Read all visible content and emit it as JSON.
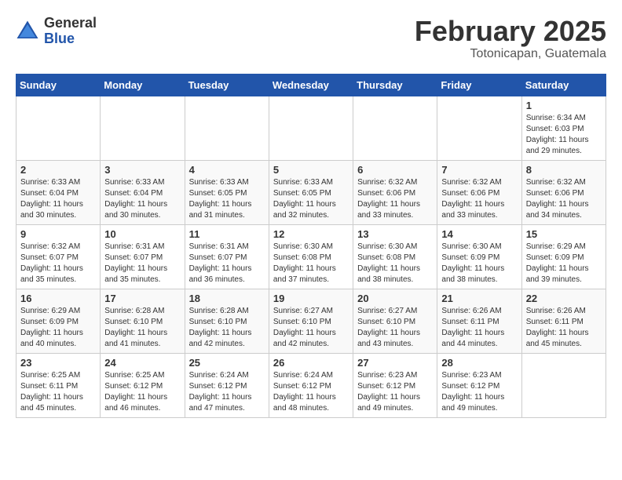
{
  "logo": {
    "general": "General",
    "blue": "Blue"
  },
  "title": "February 2025",
  "subtitle": "Totonicapan, Guatemala",
  "weekdays": [
    "Sunday",
    "Monday",
    "Tuesday",
    "Wednesday",
    "Thursday",
    "Friday",
    "Saturday"
  ],
  "weeks": [
    [
      {
        "day": "",
        "info": ""
      },
      {
        "day": "",
        "info": ""
      },
      {
        "day": "",
        "info": ""
      },
      {
        "day": "",
        "info": ""
      },
      {
        "day": "",
        "info": ""
      },
      {
        "day": "",
        "info": ""
      },
      {
        "day": "1",
        "info": "Sunrise: 6:34 AM\nSunset: 6:03 PM\nDaylight: 11 hours and 29 minutes."
      }
    ],
    [
      {
        "day": "2",
        "info": "Sunrise: 6:33 AM\nSunset: 6:04 PM\nDaylight: 11 hours and 30 minutes."
      },
      {
        "day": "3",
        "info": "Sunrise: 6:33 AM\nSunset: 6:04 PM\nDaylight: 11 hours and 30 minutes."
      },
      {
        "day": "4",
        "info": "Sunrise: 6:33 AM\nSunset: 6:05 PM\nDaylight: 11 hours and 31 minutes."
      },
      {
        "day": "5",
        "info": "Sunrise: 6:33 AM\nSunset: 6:05 PM\nDaylight: 11 hours and 32 minutes."
      },
      {
        "day": "6",
        "info": "Sunrise: 6:32 AM\nSunset: 6:06 PM\nDaylight: 11 hours and 33 minutes."
      },
      {
        "day": "7",
        "info": "Sunrise: 6:32 AM\nSunset: 6:06 PM\nDaylight: 11 hours and 33 minutes."
      },
      {
        "day": "8",
        "info": "Sunrise: 6:32 AM\nSunset: 6:06 PM\nDaylight: 11 hours and 34 minutes."
      }
    ],
    [
      {
        "day": "9",
        "info": "Sunrise: 6:32 AM\nSunset: 6:07 PM\nDaylight: 11 hours and 35 minutes."
      },
      {
        "day": "10",
        "info": "Sunrise: 6:31 AM\nSunset: 6:07 PM\nDaylight: 11 hours and 35 minutes."
      },
      {
        "day": "11",
        "info": "Sunrise: 6:31 AM\nSunset: 6:07 PM\nDaylight: 11 hours and 36 minutes."
      },
      {
        "day": "12",
        "info": "Sunrise: 6:30 AM\nSunset: 6:08 PM\nDaylight: 11 hours and 37 minutes."
      },
      {
        "day": "13",
        "info": "Sunrise: 6:30 AM\nSunset: 6:08 PM\nDaylight: 11 hours and 38 minutes."
      },
      {
        "day": "14",
        "info": "Sunrise: 6:30 AM\nSunset: 6:09 PM\nDaylight: 11 hours and 38 minutes."
      },
      {
        "day": "15",
        "info": "Sunrise: 6:29 AM\nSunset: 6:09 PM\nDaylight: 11 hours and 39 minutes."
      }
    ],
    [
      {
        "day": "16",
        "info": "Sunrise: 6:29 AM\nSunset: 6:09 PM\nDaylight: 11 hours and 40 minutes."
      },
      {
        "day": "17",
        "info": "Sunrise: 6:28 AM\nSunset: 6:10 PM\nDaylight: 11 hours and 41 minutes."
      },
      {
        "day": "18",
        "info": "Sunrise: 6:28 AM\nSunset: 6:10 PM\nDaylight: 11 hours and 42 minutes."
      },
      {
        "day": "19",
        "info": "Sunrise: 6:27 AM\nSunset: 6:10 PM\nDaylight: 11 hours and 42 minutes."
      },
      {
        "day": "20",
        "info": "Sunrise: 6:27 AM\nSunset: 6:10 PM\nDaylight: 11 hours and 43 minutes."
      },
      {
        "day": "21",
        "info": "Sunrise: 6:26 AM\nSunset: 6:11 PM\nDaylight: 11 hours and 44 minutes."
      },
      {
        "day": "22",
        "info": "Sunrise: 6:26 AM\nSunset: 6:11 PM\nDaylight: 11 hours and 45 minutes."
      }
    ],
    [
      {
        "day": "23",
        "info": "Sunrise: 6:25 AM\nSunset: 6:11 PM\nDaylight: 11 hours and 45 minutes."
      },
      {
        "day": "24",
        "info": "Sunrise: 6:25 AM\nSunset: 6:12 PM\nDaylight: 11 hours and 46 minutes."
      },
      {
        "day": "25",
        "info": "Sunrise: 6:24 AM\nSunset: 6:12 PM\nDaylight: 11 hours and 47 minutes."
      },
      {
        "day": "26",
        "info": "Sunrise: 6:24 AM\nSunset: 6:12 PM\nDaylight: 11 hours and 48 minutes."
      },
      {
        "day": "27",
        "info": "Sunrise: 6:23 AM\nSunset: 6:12 PM\nDaylight: 11 hours and 49 minutes."
      },
      {
        "day": "28",
        "info": "Sunrise: 6:23 AM\nSunset: 6:12 PM\nDaylight: 11 hours and 49 minutes."
      },
      {
        "day": "",
        "info": ""
      }
    ]
  ]
}
